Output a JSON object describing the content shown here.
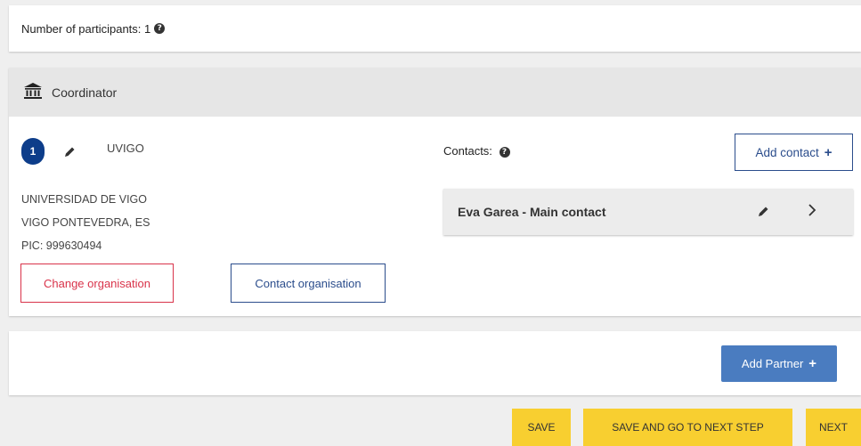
{
  "participants": {
    "label": "Number of participants: 1",
    "help": "?"
  },
  "coordinator": {
    "icon": "bank-icon",
    "title": "Coordinator",
    "number": "1",
    "org_name": "UVIGO",
    "address_lines": [
      "UNIVERSIDAD DE VIGO",
      "VIGO PONTEVEDRA, ES",
      "PIC: 999630494"
    ],
    "change_label": "Change organisation",
    "contact_org_label": "Contact organisation",
    "contacts_label": "Contacts:",
    "contacts_help": "?",
    "add_contact_label": "Add contact",
    "add_contact_plus": "+",
    "contacts": [
      {
        "name": "Eva Garea - Main contact"
      }
    ]
  },
  "partners": {
    "add_partner_label": "Add Partner",
    "add_partner_plus": "+"
  },
  "footer": {
    "save_label": "SAVE",
    "save_next_label": "SAVE AND GO TO NEXT STEP",
    "next_label": "NEXT"
  },
  "colors": {
    "primary_navy": "#0d3d8a",
    "outline_blue": "#2b4d8c",
    "danger": "#d9334a",
    "partner_button": "#4a7cc0",
    "action_yellow": "#f8cf30",
    "header_grey": "#e6e6e6",
    "background": "#efefef"
  }
}
